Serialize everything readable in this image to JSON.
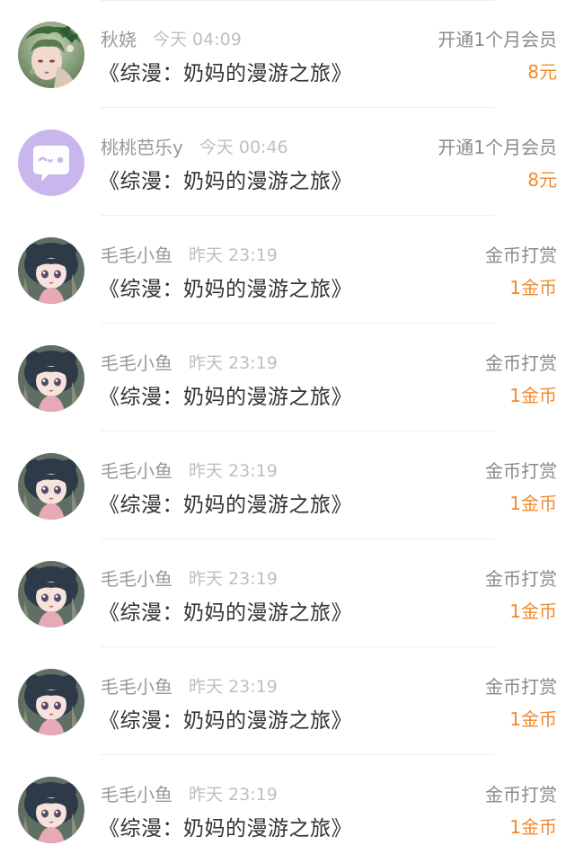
{
  "items": [
    {
      "username": "秋娆",
      "time": "今天 04:09",
      "title": "《综漫：奶妈的漫游之旅》",
      "action": "开通1个月会员",
      "amount": "8元",
      "avatar_icon": "anime-girl-green-hair-avatar"
    },
    {
      "username": "桃桃芭乐y",
      "time": "今天 00:46",
      "title": "《综漫：奶妈的漫游之旅》",
      "action": "开通1个月会员",
      "amount": "8元",
      "avatar_icon": "chat-bubble-face-avatar"
    },
    {
      "username": "毛毛小鱼",
      "time": "昨天 23:19",
      "title": "《综漫：奶妈的漫游之旅》",
      "action": "金币打赏",
      "amount": "1金币",
      "avatar_icon": "anime-girl-dark-hair-avatar"
    },
    {
      "username": "毛毛小鱼",
      "time": "昨天 23:19",
      "title": "《综漫：奶妈的漫游之旅》",
      "action": "金币打赏",
      "amount": "1金币",
      "avatar_icon": "anime-girl-dark-hair-avatar"
    },
    {
      "username": "毛毛小鱼",
      "time": "昨天 23:19",
      "title": "《综漫：奶妈的漫游之旅》",
      "action": "金币打赏",
      "amount": "1金币",
      "avatar_icon": "anime-girl-dark-hair-avatar"
    },
    {
      "username": "毛毛小鱼",
      "time": "昨天 23:19",
      "title": "《综漫：奶妈的漫游之旅》",
      "action": "金币打赏",
      "amount": "1金币",
      "avatar_icon": "anime-girl-dark-hair-avatar"
    },
    {
      "username": "毛毛小鱼",
      "time": "昨天 23:19",
      "title": "《综漫：奶妈的漫游之旅》",
      "action": "金币打赏",
      "amount": "1金币",
      "avatar_icon": "anime-girl-dark-hair-avatar"
    },
    {
      "username": "毛毛小鱼",
      "time": "昨天 23:19",
      "title": "《综漫：奶妈的漫游之旅》",
      "action": "金币打赏",
      "amount": "1金币",
      "avatar_icon": "anime-girl-dark-hair-avatar"
    }
  ],
  "colors": {
    "amount": "#f08a2c",
    "username": "#999999",
    "time": "#bfbfbf",
    "title": "#333333",
    "action": "#8a8a8a",
    "avatar_purple": "#c9b6ec"
  }
}
